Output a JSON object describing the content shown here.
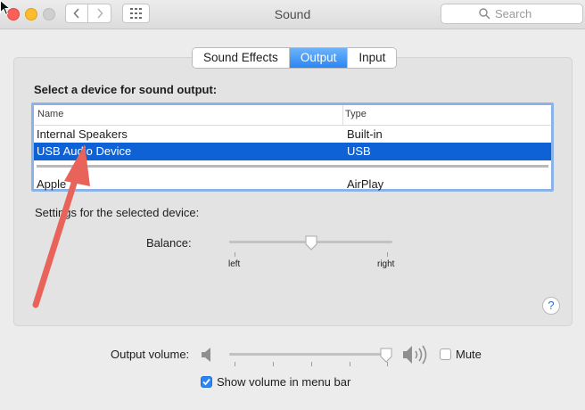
{
  "window": {
    "title": "Sound",
    "search_placeholder": "Search"
  },
  "tabs": [
    {
      "label": "Sound Effects",
      "active": false
    },
    {
      "label": "Output",
      "active": true
    },
    {
      "label": "Input",
      "active": false
    }
  ],
  "output": {
    "section_label": "Select a device for sound output:",
    "columns": {
      "name": "Name",
      "type": "Type"
    },
    "devices": [
      {
        "name": "Internal Speakers",
        "type": "Built-in",
        "selected": false
      },
      {
        "name": "USB Audio Device",
        "type": "USB",
        "selected": true
      },
      {
        "name": "Apple",
        "type": "AirPlay",
        "selected": false
      }
    ],
    "settings_label": "Settings for the selected device:",
    "balance": {
      "label": "Balance:",
      "left_label": "left",
      "right_label": "right",
      "value": 0.5
    }
  },
  "volume": {
    "label": "Output volume:",
    "value": 0.98,
    "mute_label": "Mute",
    "mute_checked": false,
    "menu_bar_label": "Show volume in menu bar",
    "menu_bar_checked": true
  },
  "help": {
    "label": "?"
  },
  "colors": {
    "accent": "#2b86f4",
    "selection": "#0f62d6",
    "annotation_arrow": "#e8645a"
  }
}
